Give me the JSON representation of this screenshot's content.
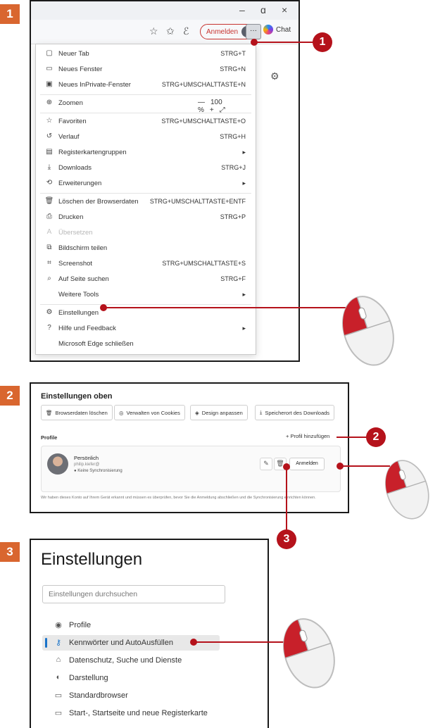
{
  "steps": [
    "1",
    "2",
    "3"
  ],
  "callouts": [
    "1",
    "2",
    "3"
  ],
  "panel1": {
    "window_controls": [
      "–",
      "ɑ",
      "×"
    ],
    "toolbar": {
      "signin_label": "Anmelden",
      "more_label": "···",
      "copilot_label": "Chat"
    },
    "menu": {
      "items": [
        {
          "icon": "▢",
          "label": "Neuer Tab",
          "shortcut": "STRG+T"
        },
        {
          "icon": "▭",
          "label": "Neues Fenster",
          "shortcut": "STRG+N"
        },
        {
          "icon": "▣",
          "label": "Neues InPrivate-Fenster",
          "shortcut": "STRG+UMSCHALTTASTE+N"
        },
        {
          "icon": "⊕",
          "label": "Zoomen",
          "shortcut": ""
        },
        {
          "icon": "☆",
          "label": "Favoriten",
          "shortcut": "STRG+UMSCHALTTASTE+O"
        },
        {
          "icon": "↺",
          "label": "Verlauf",
          "shortcut": "STRG+H"
        },
        {
          "icon": "▤",
          "label": "Registerkartengruppen",
          "shortcut": "▸"
        },
        {
          "icon": "⤓",
          "label": "Downloads",
          "shortcut": "STRG+J"
        },
        {
          "icon": "⟲",
          "label": "Erweiterungen",
          "shortcut": "▸"
        },
        {
          "icon": "🗑",
          "label": "Löschen der Browserdaten",
          "shortcut": "STRG+UMSCHALTTASTE+ENTF"
        },
        {
          "icon": "⎙",
          "label": "Drucken",
          "shortcut": "STRG+P"
        },
        {
          "icon": "A",
          "label": "Übersetzen",
          "shortcut": ""
        },
        {
          "icon": "⧉",
          "label": "Bildschirm teilen",
          "shortcut": ""
        },
        {
          "icon": "⌗",
          "label": "Screenshot",
          "shortcut": "STRG+UMSCHALTTASTE+S"
        },
        {
          "icon": "⌕",
          "label": "Auf Seite suchen",
          "shortcut": "STRG+F"
        },
        {
          "icon": "",
          "label": "Weitere Tools",
          "shortcut": "▸"
        },
        {
          "icon": "⚙",
          "label": "Einstellungen",
          "shortcut": ""
        },
        {
          "icon": "?",
          "label": "Hilfe und Feedback",
          "shortcut": "▸"
        },
        {
          "icon": "",
          "label": "Microsoft Edge schließen",
          "shortcut": ""
        }
      ],
      "zoom": {
        "minus": "—",
        "value": "100 %",
        "plus": "+",
        "fullscreen": "⤢"
      }
    }
  },
  "panel2": {
    "title": "Einstellungen oben",
    "quick_actions": [
      {
        "icon": "🗑",
        "label": "Browserdaten löschen"
      },
      {
        "icon": "◎",
        "label": "Verwalten von Cookies"
      },
      {
        "icon": "◈",
        "label": "Design anpassen"
      },
      {
        "icon": "⤓",
        "label": "Speicherort des Downloads"
      }
    ],
    "section_label": "Profile",
    "add_profile": "+  Profil hinzufügen",
    "profile": {
      "name": "Persönlich",
      "email": "philip.kiefer@",
      "sync": "● Keine Synchronisierung",
      "edit_icon": "✎",
      "delete_icon": "🗑",
      "signin": "Anmelden"
    },
    "note": "Wir haben dieses Konto auf Ihrem Gerät erkannt und müssen es überprüfen, bevor Sie die Anmeldung abschließen und die Synchronisierung einrichten können."
  },
  "panel3": {
    "title": "Einstellungen",
    "search_placeholder": "Einstellungen durchsuchen",
    "nav": [
      {
        "icon": "◉",
        "label": "Profile"
      },
      {
        "icon": "⚷",
        "label": "Kennwörter und AutoAusfüllen"
      },
      {
        "icon": "⌂",
        "label": "Datenschutz, Suche und Dienste"
      },
      {
        "icon": "◐",
        "label": "Darstellung"
      },
      {
        "icon": "▭",
        "label": "Standardbrowser"
      },
      {
        "icon": "▭",
        "label": "Start-, Startseite und neue Registerkarte"
      }
    ]
  },
  "colors": {
    "step_badge": "#d9662f",
    "callout_red": "#b5121b",
    "accent_blue": "#1a73c9"
  }
}
